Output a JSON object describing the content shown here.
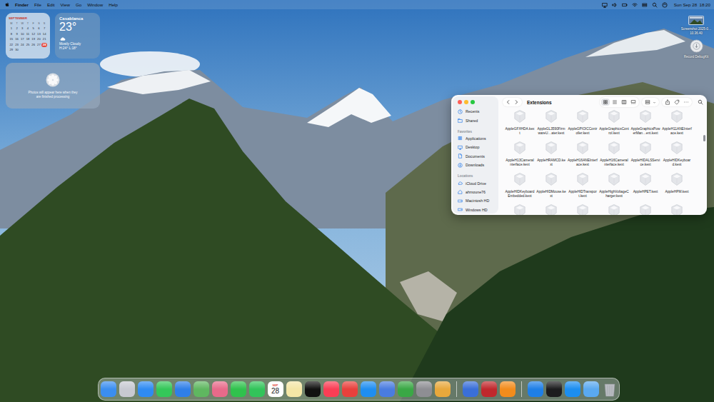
{
  "menu_bar": {
    "app": "Finder",
    "menus": [
      "File",
      "Edit",
      "View",
      "Go",
      "Window",
      "Help"
    ],
    "clock": "Sun Sep 28  18:20"
  },
  "calendar_widget": {
    "month": "SEPTEMBER",
    "weekdays": [
      "M",
      "T",
      "W",
      "T",
      "F",
      "S",
      "S"
    ],
    "days": [
      {
        "day": "1",
        "selected": false
      },
      {
        "day": "2",
        "selected": false
      },
      {
        "day": "3",
        "selected": false
      },
      {
        "day": "4",
        "selected": false
      },
      {
        "day": "5",
        "selected": false
      },
      {
        "day": "6",
        "selected": false
      },
      {
        "day": "7",
        "selected": false
      },
      {
        "day": "8",
        "selected": false
      },
      {
        "day": "9",
        "selected": false
      },
      {
        "day": "10",
        "selected": false
      },
      {
        "day": "11",
        "selected": false
      },
      {
        "day": "12",
        "selected": false
      },
      {
        "day": "13",
        "selected": false
      },
      {
        "day": "14",
        "selected": false
      },
      {
        "day": "15",
        "selected": false
      },
      {
        "day": "16",
        "selected": false
      },
      {
        "day": "17",
        "selected": false
      },
      {
        "day": "18",
        "selected": false
      },
      {
        "day": "19",
        "selected": false
      },
      {
        "day": "20",
        "selected": false
      },
      {
        "day": "21",
        "selected": false
      },
      {
        "day": "22",
        "selected": false
      },
      {
        "day": "23",
        "selected": false
      },
      {
        "day": "24",
        "selected": false
      },
      {
        "day": "25",
        "selected": false
      },
      {
        "day": "26",
        "selected": false
      },
      {
        "day": "27",
        "selected": false
      },
      {
        "day": "28",
        "selected": true
      },
      {
        "day": "29",
        "selected": false
      },
      {
        "day": "30",
        "selected": false
      }
    ]
  },
  "weather_widget": {
    "city": "Casablanca",
    "temperature": "23°",
    "condition": "Mostly Cloudy",
    "range": "H:24° L:18°"
  },
  "photos_widget": {
    "message": "Photos will appear here when they are finished processing"
  },
  "desktop_icons": [
    {
      "label": "Screenshot 2025-0…10.36.40",
      "kind": "screenshot"
    },
    {
      "label": "Record DebugKit",
      "kind": "disk"
    }
  ],
  "finder": {
    "title": "Extensions",
    "view_modes": [
      {
        "selected": true
      },
      {
        "selected": false
      },
      {
        "selected": false
      },
      {
        "selected": false
      }
    ],
    "sidebar": [
      {
        "kind": "item",
        "label": "Recents",
        "selected": false
      },
      {
        "kind": "item",
        "label": "Shared",
        "selected": false
      },
      {
        "kind": "header",
        "label": "Favorites",
        "selected": false
      },
      {
        "kind": "item",
        "label": "Applications",
        "selected": false
      },
      {
        "kind": "item",
        "label": "Desktop",
        "selected": false
      },
      {
        "kind": "item",
        "label": "Documents",
        "selected": false
      },
      {
        "kind": "item",
        "label": "Downloads",
        "selected": false
      },
      {
        "kind": "header",
        "label": "Locations",
        "selected": false
      },
      {
        "kind": "item",
        "label": "iCloud Drive",
        "selected": false
      },
      {
        "kind": "item",
        "label": "ahmoune76",
        "selected": false
      },
      {
        "kind": "item",
        "label": "Macintosh HD",
        "selected": false
      },
      {
        "kind": "item",
        "label": "Windows HD",
        "selected": false
      }
    ],
    "files": [
      {
        "name": "AppleGFXHDA.kext",
        "selected": false
      },
      {
        "name": "AppleGL3590FirmwareU…ater.kext",
        "selected": false
      },
      {
        "name": "AppleGPIOICController.kext",
        "selected": false
      },
      {
        "name": "AppleGraphicsControl.kext",
        "selected": false
      },
      {
        "name": "AppleGraphicsPowerMan…ent.kext",
        "selected": false
      },
      {
        "name": "AppleH11ANEInterface.kext",
        "selected": false
      },
      {
        "name": "AppleH13CameraInterface.kext",
        "selected": false
      },
      {
        "name": "AppleHRAMCD.kext",
        "selected": false
      },
      {
        "name": "AppleH16ANEInterface.kext",
        "selected": false
      },
      {
        "name": "AppleH16CameraInterface.kext",
        "selected": false
      },
      {
        "name": "AppleHIDALSService.kext",
        "selected": false
      },
      {
        "name": "AppleHIDKeyboard.kext",
        "selected": false
      },
      {
        "name": "AppleHIDKeyboardEmbedded.kext",
        "selected": false
      },
      {
        "name": "AppleHIDMouse.kext",
        "selected": false
      },
      {
        "name": "AppleHIDTransport.kext",
        "selected": false
      },
      {
        "name": "AppleHighVoltageCharger.kext",
        "selected": false
      },
      {
        "name": "AppleHPET.kext",
        "selected": false
      },
      {
        "name": "AppleHPM.kext",
        "selected": false
      },
      {
        "name": "",
        "selected": false
      },
      {
        "name": "",
        "selected": false
      },
      {
        "name": "",
        "selected": false
      },
      {
        "name": "",
        "selected": false
      },
      {
        "name": "",
        "selected": false
      },
      {
        "name": "",
        "selected": false
      }
    ]
  },
  "dock": [
    {
      "kind": "app",
      "color": "#3b8ef0"
    },
    {
      "kind": "app",
      "color": "#c7c9d1"
    },
    {
      "kind": "app",
      "color": "#2f8bf2"
    },
    {
      "kind": "app",
      "color": "#34c759"
    },
    {
      "kind": "app",
      "color": "#2f7fe8"
    },
    {
      "kind": "app",
      "color": "#5fb760"
    },
    {
      "kind": "app",
      "color": "#e86a8a"
    },
    {
      "kind": "app",
      "color": "#30c24d"
    },
    {
      "kind": "app",
      "color": "#32c45a"
    },
    {
      "kind": "calendar",
      "color": "#ffffff",
      "month": "SEP",
      "day": "28"
    },
    {
      "kind": "app",
      "color": "#f4e6a6"
    },
    {
      "kind": "app",
      "color": "#111111"
    },
    {
      "kind": "app",
      "color": "#fa3e55"
    },
    {
      "kind": "app",
      "color": "#e8403c"
    },
    {
      "kind": "app",
      "color": "#1f8ef1"
    },
    {
      "kind": "app",
      "color": "#4a7ce0"
    },
    {
      "kind": "app",
      "color": "#3aa845"
    },
    {
      "kind": "app",
      "color": "#8e8e93"
    },
    {
      "kind": "app",
      "color": "#e8a83c"
    },
    {
      "kind": "separator",
      "color": "#ffffff"
    },
    {
      "kind": "app",
      "color": "#3a6fd8"
    },
    {
      "kind": "app",
      "color": "#c0282d"
    },
    {
      "kind": "app",
      "color": "#f28c1c"
    },
    {
      "kind": "separator",
      "color": "#ffffff"
    },
    {
      "kind": "app",
      "color": "#1f7fe6"
    },
    {
      "kind": "app",
      "color": "#1c1c1e"
    },
    {
      "kind": "app",
      "color": "#1c8ef0"
    },
    {
      "kind": "app",
      "color": "#5aa9f0"
    },
    {
      "kind": "trash",
      "color": "#b9bcc2"
    }
  ]
}
